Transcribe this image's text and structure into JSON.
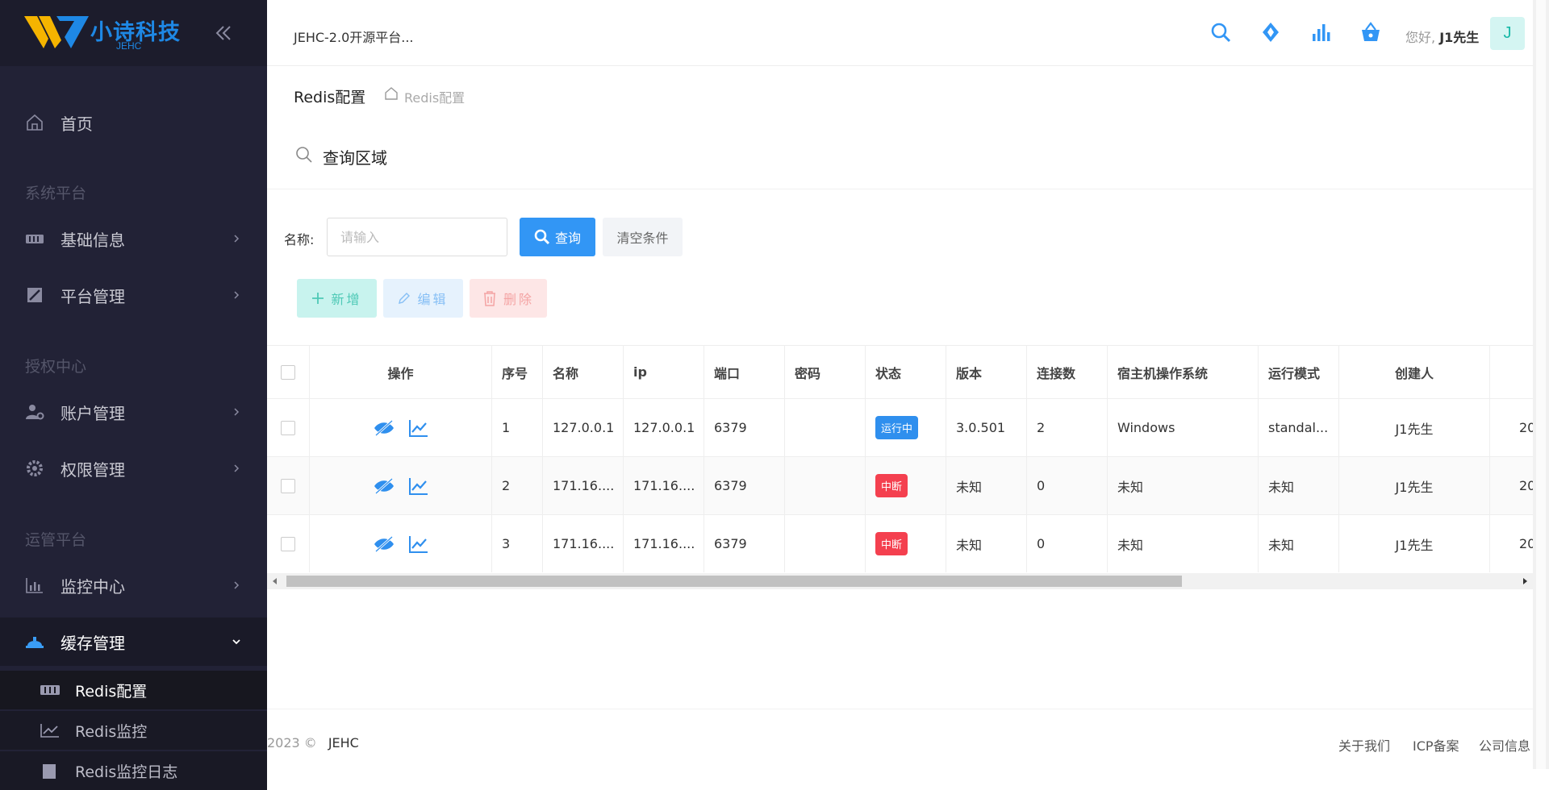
{
  "brand": {
    "name": "小诗科技",
    "sub": "JEHC",
    "colors": {
      "primary": "#1e88e5",
      "logo_yellow": "#f5b400"
    }
  },
  "header": {
    "app_title": "JEHC-2.0开源平台...",
    "greeting": "您好,",
    "user": "J1先生",
    "avatar": "J",
    "icons": [
      "search-icon",
      "diamond-icon",
      "chart-icon",
      "basket-icon"
    ]
  },
  "sidebar": {
    "home": "首页",
    "group1": "系统平台",
    "basic_info": "基础信息",
    "platform_mgmt": "平台管理",
    "group2": "授权中心",
    "account_mgmt": "账户管理",
    "permission_mgmt": "权限管理",
    "group3": "运管平台",
    "monitor_center": "监控中心",
    "cache_mgmt": "缓存管理",
    "sub_items": [
      "Redis配置",
      "Redis监控",
      "Redis监控日志"
    ]
  },
  "breadcrumb": {
    "title": "Redis配置",
    "link": "Redis配置"
  },
  "query": {
    "section_title": "查询区域",
    "name_label": "名称:",
    "name_placeholder": "请输入",
    "search_button": "查询",
    "clear_button": "清空条件"
  },
  "actions": {
    "add": "新增",
    "edit": "编辑",
    "delete": "删除"
  },
  "table": {
    "headers": [
      "操作",
      "序号",
      "名称",
      "ip",
      "端口",
      "密码",
      "状态",
      "版本",
      "连接数",
      "宿主机操作系统",
      "运行模式",
      "创建人"
    ],
    "rows": [
      {
        "index": "1",
        "name": "127.0.0.1",
        "ip": "127.0.0.1",
        "port": "6379",
        "password": "",
        "status": "运行中",
        "status_type": "running",
        "version": "3.0.501",
        "connections": "2",
        "os": "Windows",
        "mode": "standal...",
        "creator": "J1先生",
        "extra": "20"
      },
      {
        "index": "2",
        "name": "171.16....",
        "ip": "171.16....",
        "port": "6379",
        "password": "",
        "status": "中断",
        "status_type": "stopped",
        "version": "未知",
        "connections": "0",
        "os": "未知",
        "mode": "未知",
        "creator": "J1先生",
        "extra": "20"
      },
      {
        "index": "3",
        "name": "171.16....",
        "ip": "171.16....",
        "port": "6379",
        "password": "",
        "status": "中断",
        "status_type": "stopped",
        "version": "未知",
        "connections": "0",
        "os": "未知",
        "mode": "未知",
        "creator": "J1先生",
        "extra": "20"
      }
    ]
  },
  "footer": {
    "copyright": "2023 ©",
    "brand": "JEHC",
    "links": [
      "关于我们",
      "ICP备案",
      "公司信息"
    ]
  }
}
